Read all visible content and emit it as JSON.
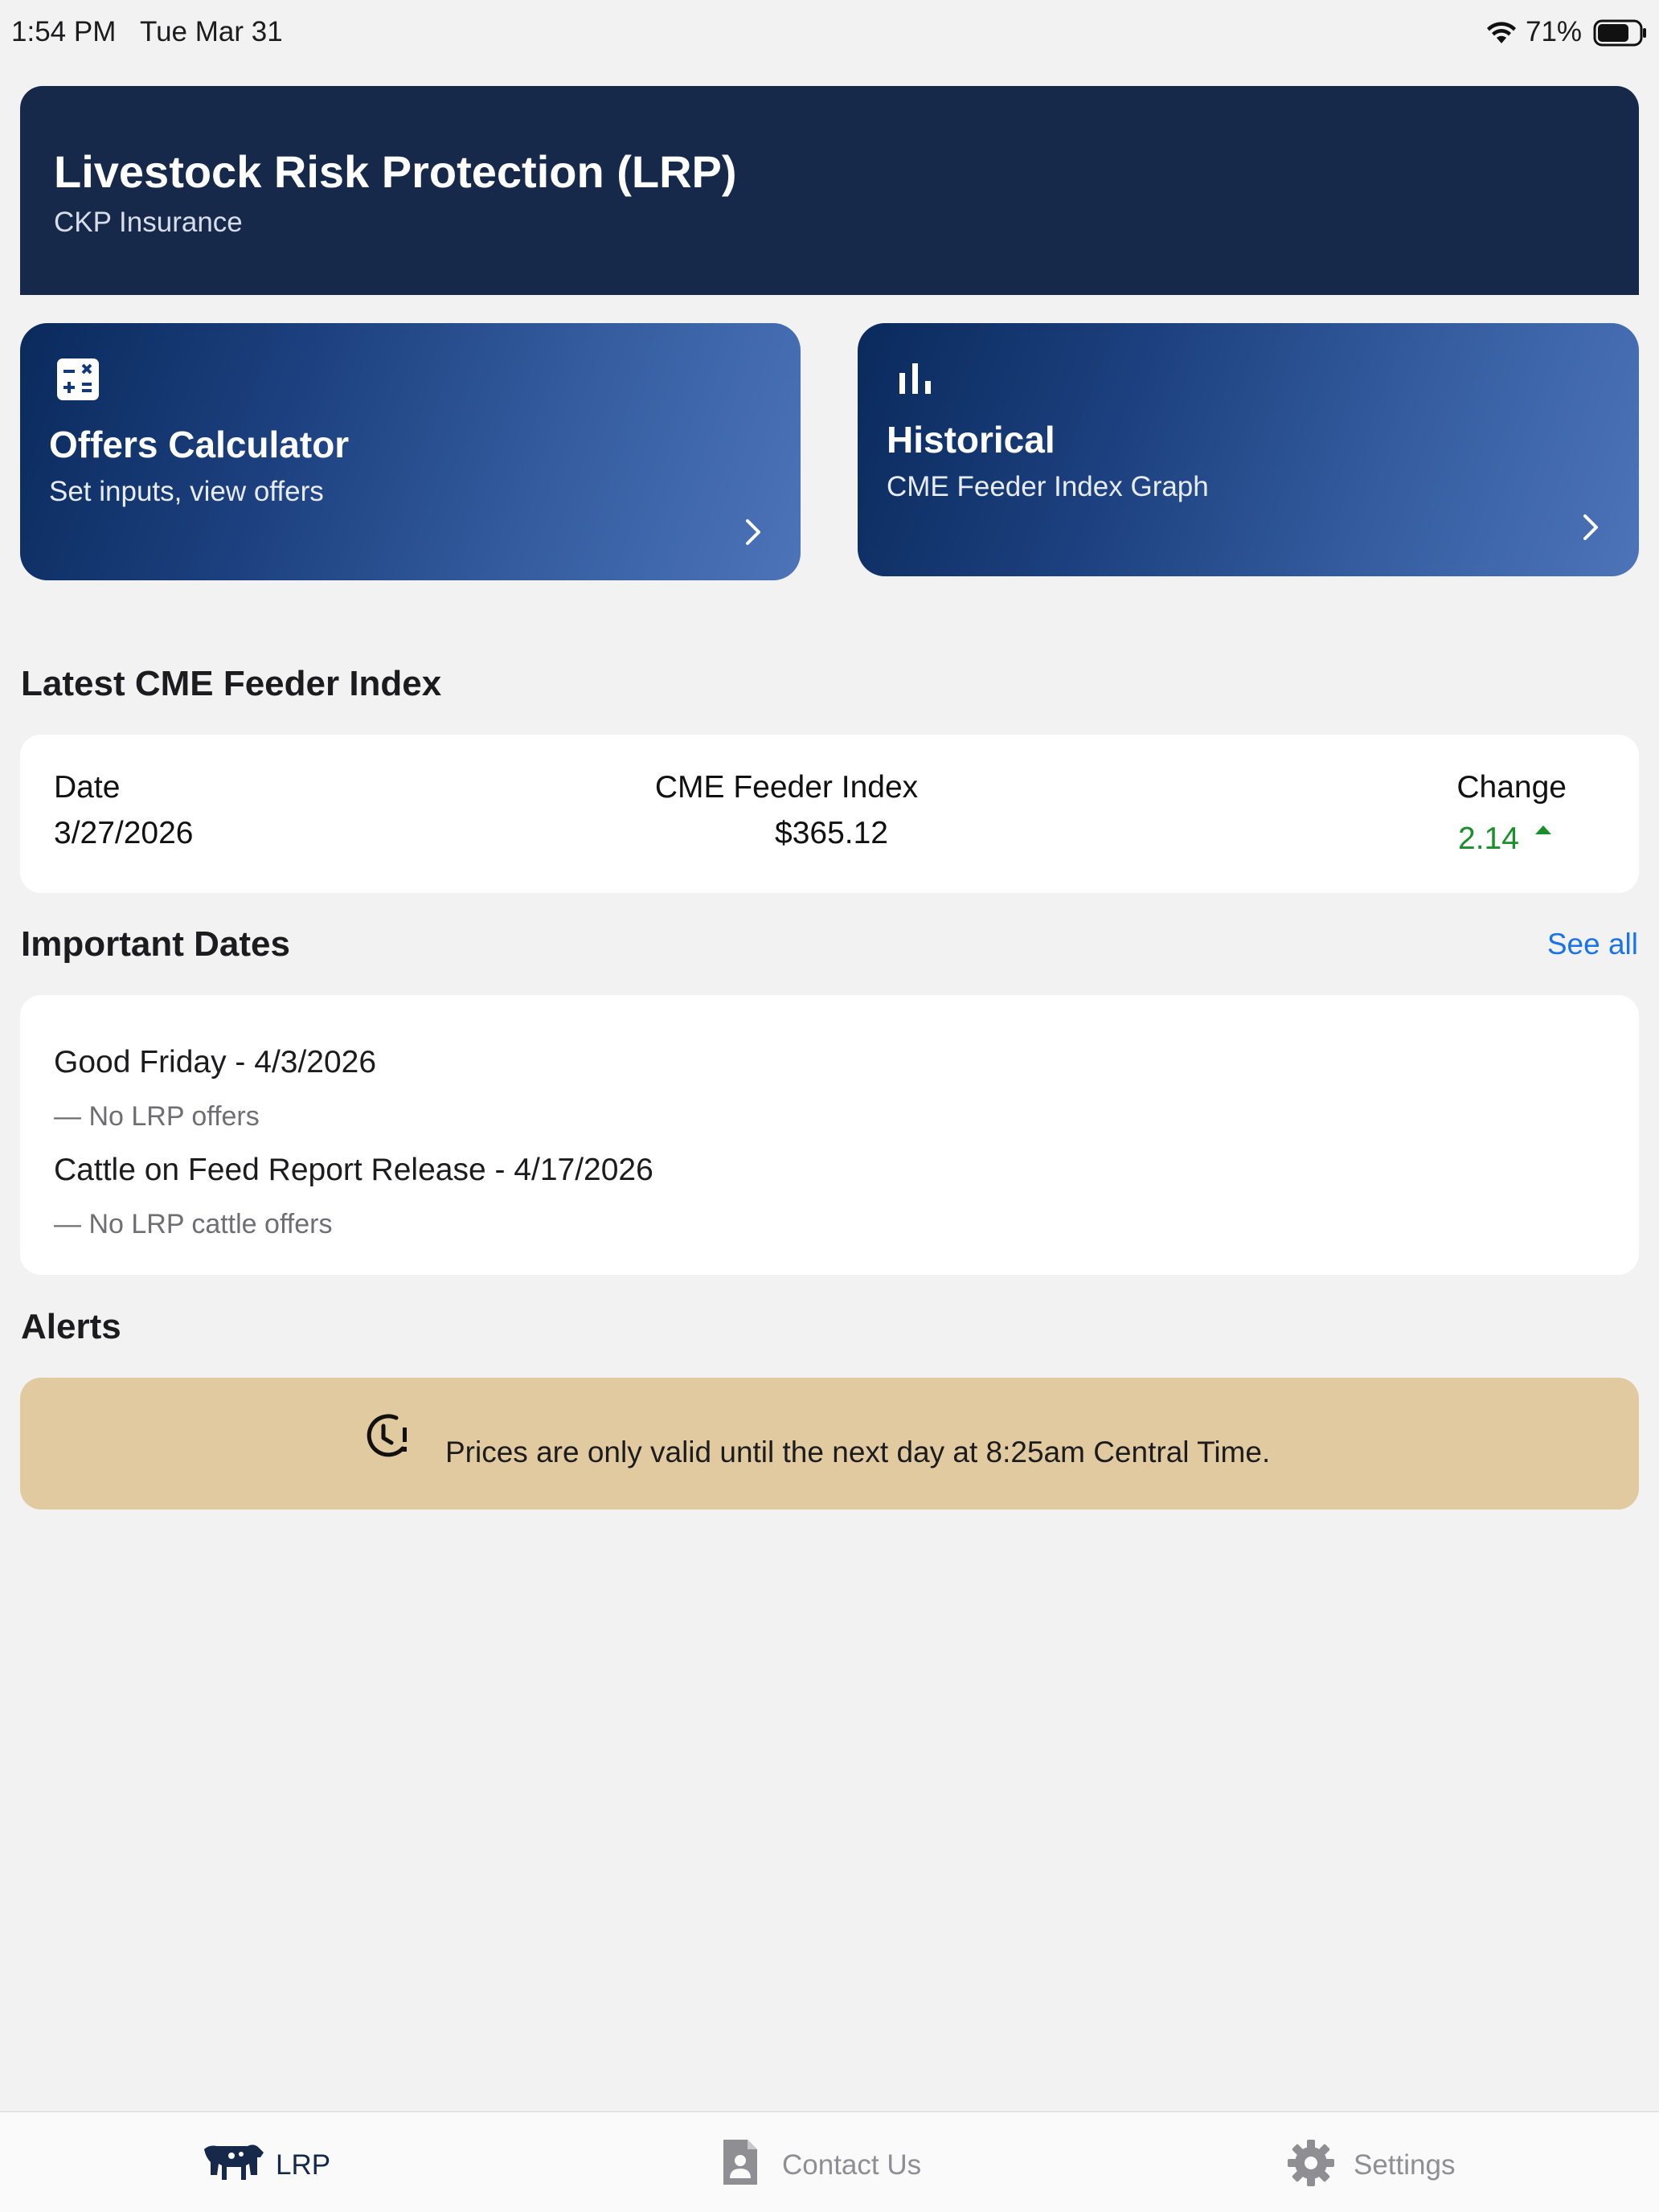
{
  "status_bar": {
    "time": "1:54 PM",
    "date": "Tue Mar 31",
    "battery_percent": "71%",
    "battery_level": 0.71
  },
  "header": {
    "title": "Livestock Risk Protection (LRP)",
    "subtitle": "CKP Insurance"
  },
  "cards": {
    "offers": {
      "title": "Offers Calculator",
      "subtitle": "Set inputs, view offers",
      "icon": "calculator-icon"
    },
    "historical": {
      "title": "Historical",
      "subtitle": "CME Feeder Index Graph",
      "icon": "bar-chart-icon"
    }
  },
  "latest_index": {
    "section_title": "Latest CME Feeder Index",
    "date_label": "Date",
    "date_value": "3/27/2026",
    "index_label": "CME Feeder Index",
    "index_value": "$365.12",
    "change_label": "Change",
    "change_value": "2.14",
    "change_direction": "up",
    "change_color": "#1a8f2a"
  },
  "important_dates": {
    "section_title": "Important Dates",
    "see_all": "See all",
    "items": [
      {
        "title": "Good Friday - 4/3/2026",
        "note": "— No LRP offers"
      },
      {
        "title": "Cattle on Feed Report Release - 4/17/2026",
        "note": "— No LRP cattle offers"
      }
    ]
  },
  "alerts": {
    "section_title": "Alerts",
    "message": "Prices are only valid until the next day at 8:25am Central Time.",
    "icon": "clock-alert-icon",
    "background": "#e2caa0"
  },
  "tab_bar": {
    "tabs": [
      {
        "label": "LRP",
        "icon": "cow-icon",
        "active": true
      },
      {
        "label": "Contact Us",
        "icon": "contact-icon",
        "active": false
      },
      {
        "label": "Settings",
        "icon": "gear-icon",
        "active": false
      }
    ],
    "active_color": "#16294b",
    "inactive_color": "#8e8e93"
  },
  "colors": {
    "header_bg": "#16294b",
    "card_gradient_start": "#0a2a5c",
    "card_gradient_end": "#4d73b9",
    "link": "#1a73e8",
    "page_bg": "#f2f2f2"
  }
}
